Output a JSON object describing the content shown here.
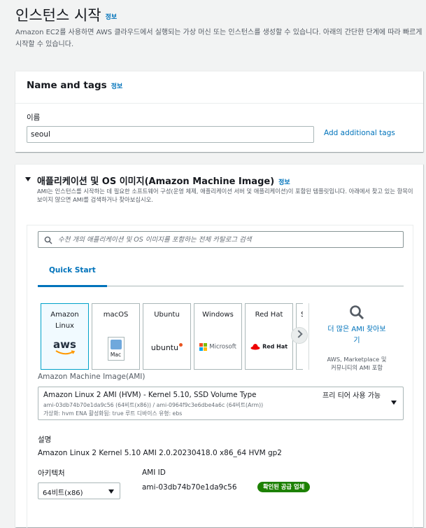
{
  "page": {
    "title": "인스턴스 시작",
    "info": "정보",
    "description": "Amazon EC2를 사용하면 AWS 클라우드에서 실행되는 가상 머신 또는 인스턴스를 생성할 수 있습니다. 아래의 간단한 단계에 따라 빠르게 시작할 수 있습니다."
  },
  "name_tags": {
    "title": "Name and tags",
    "info": "정보",
    "name_label": "이름",
    "name_value": "seoul",
    "add_tags": "Add additional tags"
  },
  "ami": {
    "title": "애플리케이션 및 OS 이미지(Amazon Machine Image)",
    "info": "정보",
    "description": "AMI는 인스턴스를 시작하는 데 필요한 소프트웨어 구성(운영 체제, 애플리케이션 서버 및 애플리케이션)이 포함된 템플릿입니다. 아래에서 찾고 있는 항목이 보이지 않으면 AMI를 검색하거나 찾아보십시오.",
    "search_placeholder": "수천 개의 애플리케이션 및 OS 이미지를 포함하는 전체 카탈로그 검색",
    "tab_quick_start": "Quick Start",
    "os_tiles": [
      {
        "name_line1": "Amazon",
        "name_line2": "Linux",
        "logo_text": "aws",
        "selected": true
      },
      {
        "name_line1": "macOS",
        "logo_text": "Mac"
      },
      {
        "name_line1": "Ubuntu",
        "logo_text": "ubuntu"
      },
      {
        "name_line1": "Windows",
        "logo_text": "Microsoft"
      },
      {
        "name_line1": "Red Hat",
        "logo_text": "Red Hat"
      },
      {
        "name_line1": "S"
      }
    ],
    "more_ami": "더 많은 AMI 찾아보기",
    "more_ami_sub": "AWS, Marketplace 및 커뮤니티의 AMI 포함",
    "ami_label": "Amazon Machine Image(AMI)",
    "selected_ami": {
      "title": "Amazon Linux 2 AMI (HVM) - Kernel 5.10, SSD Volume Type",
      "free_tier": "프리 티어 사용 가능",
      "ids": "ami-03db74b70e1da9c56 (64비트(x86)) / ami-0964f9c3e6dbe4a6c (64비트(Arm))",
      "meta": "가상화: hvm    ENA 활성화됨: true    루트 디바이스 유형: ebs"
    },
    "desc_label": "설명",
    "desc_value": "Amazon Linux 2 Kernel 5.10 AMI 2.0.20230418.0 x86_64 HVM gp2",
    "arch_label": "아키텍처",
    "arch_value": "64비트(x86)",
    "ami_id_label": "AMI ID",
    "ami_id_value": "ami-03db74b70e1da9c56",
    "verified_badge": "확인된 공급 업체"
  },
  "colors": {
    "accent": "#0073bb",
    "selected_border": "#00a1c9",
    "badge_green": "#1d8102",
    "aws_orange": "#ff9900",
    "redhat_red": "#ee0000",
    "ubuntu_orange": "#e95420"
  }
}
